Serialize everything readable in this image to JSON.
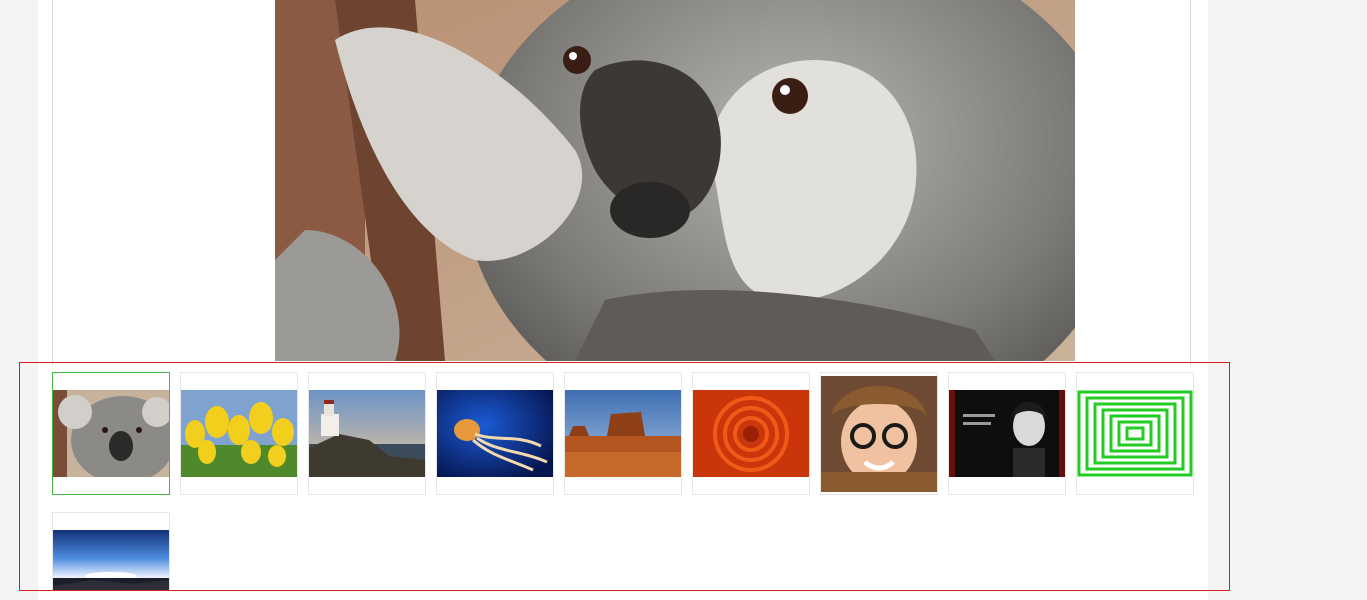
{
  "viewer": {
    "current_image": "koala",
    "selected_index": 0
  },
  "thumbnails": [
    {
      "subject": "koala",
      "selected": true
    },
    {
      "subject": "tulips",
      "selected": false
    },
    {
      "subject": "lighthouse",
      "selected": false
    },
    {
      "subject": "jellyfish",
      "selected": false
    },
    {
      "subject": "desert",
      "selected": false
    },
    {
      "subject": "chrysanthemum",
      "selected": false
    },
    {
      "subject": "child-portrait",
      "selected": false
    },
    {
      "subject": "audrey-hepburn-poster",
      "selected": false
    },
    {
      "subject": "green-squares",
      "selected": false
    },
    {
      "subject": "sunset-landscape",
      "selected": false
    }
  ],
  "colors": {
    "selected_border": "#44b844",
    "strip_border": "#d61f1f",
    "page_background": "#f4f4f4"
  }
}
